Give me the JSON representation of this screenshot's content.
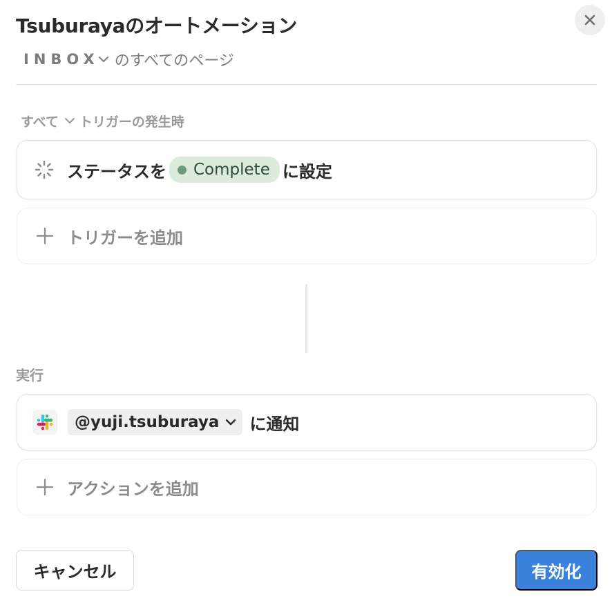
{
  "header": {
    "title": "Tsuburayaのオートメーション",
    "close_icon": "close-icon"
  },
  "scope": {
    "database": "INBOX",
    "suffix": "のすべてのページ"
  },
  "trigger_section": {
    "mode": "すべて",
    "label": "トリガーの発生時",
    "trigger": {
      "prefix": "ステータスを",
      "status_value": "Complete",
      "status_color": "#6c9b7d",
      "suffix": "に設定",
      "icon": "loading-spinner-icon"
    },
    "add_label": "トリガーを追加"
  },
  "action_section": {
    "label": "実行",
    "action": {
      "app_icon": "slack-icon",
      "recipient": "@yuji.tsuburaya",
      "suffix": "に通知"
    },
    "add_label": "アクションを追加"
  },
  "footer": {
    "cancel_label": "キャンセル",
    "enable_label": "有効化",
    "accent_color": "#3a82dc"
  }
}
